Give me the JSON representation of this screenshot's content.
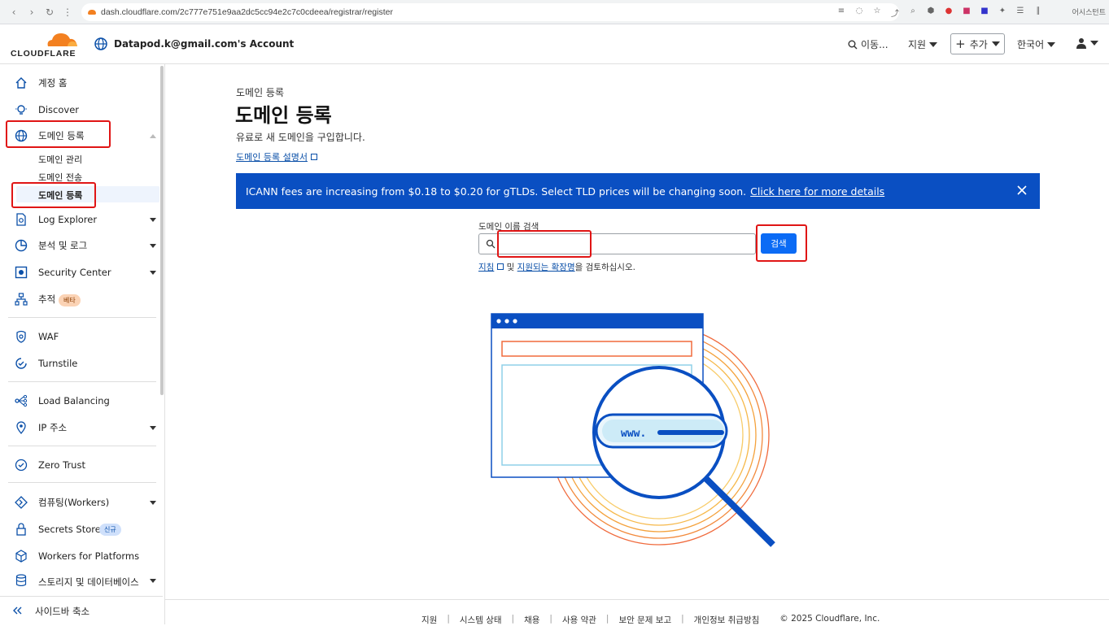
{
  "browser": {
    "url": "dash.cloudflare.com/2c777e751e9aa2dc5cc94e2c7c0cdeea/registrar/register",
    "profile_label": "어시스턴트"
  },
  "header": {
    "logo_text": "CLOUDFLARE",
    "account_name": "Datapod.k@gmail.com's Account",
    "goto_label": "이동...",
    "support_label": "지원",
    "add_label": "추가",
    "language_label": "한국어"
  },
  "sidebar": {
    "items": [
      {
        "label": "계정 홈"
      },
      {
        "label": "Discover"
      },
      {
        "label": "도메인 등록"
      },
      {
        "label": "Log Explorer"
      },
      {
        "label": "분석 및 로그"
      },
      {
        "label": "Security Center"
      },
      {
        "label": "추적",
        "badge": "베타"
      },
      {
        "label": "WAF"
      },
      {
        "label": "Turnstile"
      },
      {
        "label": "Load Balancing"
      },
      {
        "label": "IP 주소"
      },
      {
        "label": "Zero Trust"
      },
      {
        "label": "컴퓨팅(Workers)"
      },
      {
        "label": "Secrets Store",
        "badge": "신규"
      },
      {
        "label": "Workers for Platforms"
      },
      {
        "label": "스토리지 및 데이터베이스"
      }
    ],
    "subitems": [
      {
        "label": "도메인 관리"
      },
      {
        "label": "도메인 전송"
      },
      {
        "label": "도메인 등록"
      }
    ],
    "collapse_label": "사이드바 축소"
  },
  "main": {
    "breadcrumb": "도메인 등록",
    "title": "도메인 등록",
    "subtitle": "유료로 새 도메인을 구입합니다.",
    "doc_link": "도메인 등록 설명서",
    "banner_text": "ICANN fees are increasing from $0.18 to $0.20 for gTLDs. Select TLD prices will be changing soon.",
    "banner_link": "Click here for more details",
    "search_label": "도메인 이름 검색",
    "search_value": "",
    "search_button": "검색",
    "hint_link1": "지침",
    "hint_and": " 및 ",
    "hint_link2": "지원되는 확장명",
    "hint_tail": "을 검토하십시오.",
    "illustration_text": "www."
  },
  "footer": {
    "links": [
      "지원",
      "시스템 상태",
      "채용",
      "사용 약관",
      "보안 문제 보고",
      "개인정보 취급방침"
    ],
    "copyright": "© 2025 Cloudflare, Inc."
  },
  "colors": {
    "accent": "#0b6bf5",
    "banner": "#0a4fc2",
    "brand_orange": "#f38020",
    "annotation_red": "#e01515"
  }
}
